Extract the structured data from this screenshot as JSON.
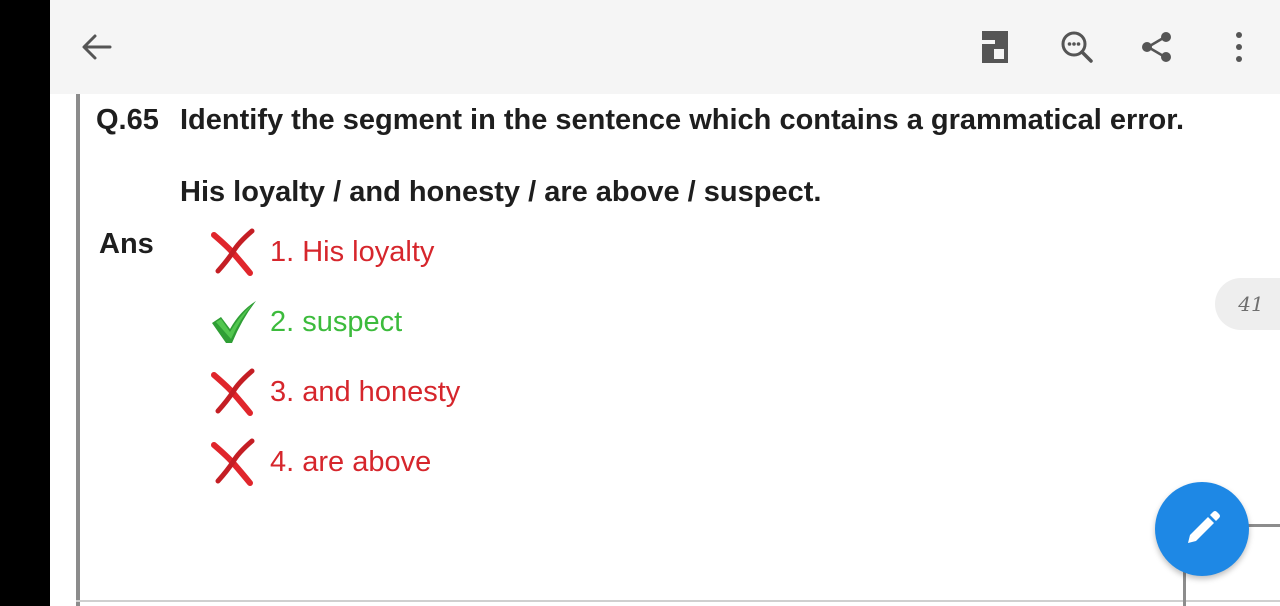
{
  "question": {
    "number": "Q.65",
    "prompt": "Identify the segment in the sentence which contains a grammatical error.",
    "sentence": "His loyalty / and honesty / are above / suspect."
  },
  "answer": {
    "label": "Ans",
    "options": [
      {
        "text": "1. His loyalty",
        "status": "wrong"
      },
      {
        "text": "2. suspect",
        "status": "correct"
      },
      {
        "text": "3. and honesty",
        "status": "wrong"
      },
      {
        "text": "4. are above",
        "status": "wrong"
      }
    ]
  },
  "page_indicator": "41",
  "icons": {
    "back": "arrow-left-icon",
    "reader": "reader-mode-icon",
    "search": "search-in-document-icon",
    "share": "share-icon",
    "more": "more-vertical-icon",
    "edit": "pencil-icon",
    "wrong": "red-cross-icon",
    "correct": "green-check-icon"
  },
  "colors": {
    "wrong": "#d6262c",
    "correct": "#3cbb3c",
    "fab": "#1e88e5",
    "toolbar": "#f5f5f5"
  }
}
